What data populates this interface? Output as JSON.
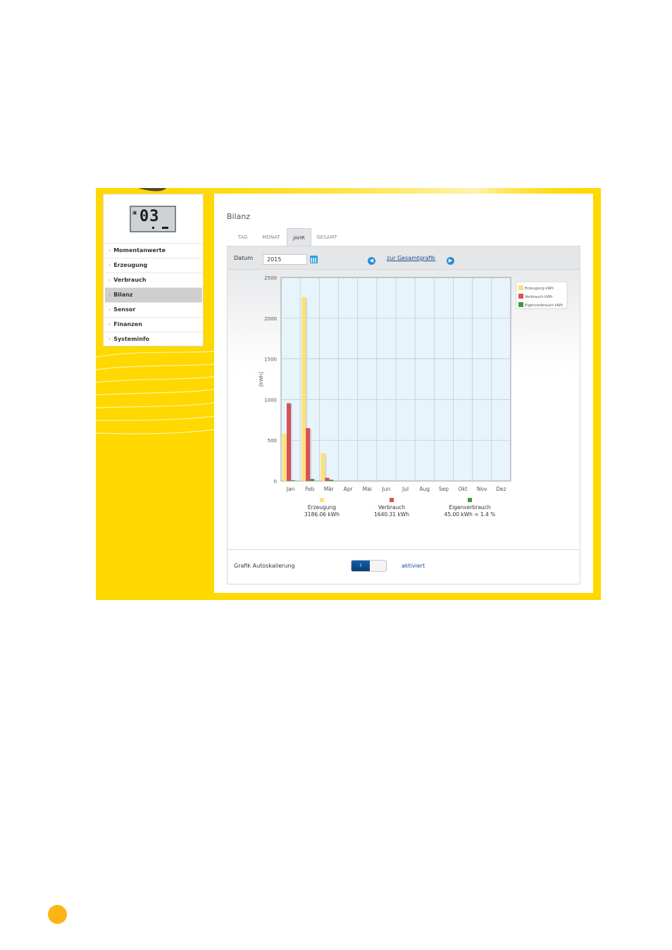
{
  "sidebar": {
    "lcd_value": "03",
    "items": [
      {
        "label": "Momentanwerte",
        "active": false
      },
      {
        "label": "Erzeugung",
        "active": false
      },
      {
        "label": "Verbrauch",
        "active": false
      },
      {
        "label": "Bilanz",
        "active": true
      },
      {
        "label": "Sensor",
        "active": false
      },
      {
        "label": "Finanzen",
        "active": false
      },
      {
        "label": "Systeminfo",
        "active": false
      }
    ]
  },
  "panel": {
    "title": "Bilanz",
    "tabs": [
      {
        "label": "TAG",
        "active": false
      },
      {
        "label": "MONAT",
        "active": false
      },
      {
        "label": "JAHR",
        "active": true
      },
      {
        "label": "GESAMT",
        "active": false
      }
    ]
  },
  "date": {
    "label": "Datum",
    "value": "2015",
    "link_label": "zur Gesamtgrafik",
    "prev_icon": "arrow-left-icon",
    "next_icon": "arrow-right-icon",
    "calendar_icon": "calendar-icon"
  },
  "autoscale": {
    "label": "Grafik Autoskalierung",
    "toggle_label": "I",
    "status": "aktiviert"
  },
  "colors": {
    "background": "#ffd800",
    "erzeugung": "#fbe27a",
    "verbrauch": "#d8505a",
    "eigenverbrauch": "#3e9a3a",
    "plot_background": "#e8f4fc",
    "link": "#1d4e8f"
  },
  "chart_data": {
    "type": "bar",
    "categories": [
      "Jan",
      "Feb",
      "Mär",
      "Apr",
      "Mai",
      "Jun",
      "Jul",
      "Aug",
      "Sep",
      "Okt",
      "Nov",
      "Dez"
    ],
    "series": [
      {
        "name": "Erzeugung kWh",
        "values": [
          580,
          2260,
          345,
          0,
          0,
          0,
          0,
          0,
          0,
          0,
          0,
          0
        ]
      },
      {
        "name": "Verbrauch kWh",
        "values": [
          955,
          650,
          40,
          0,
          0,
          0,
          0,
          0,
          0,
          0,
          0,
          0
        ]
      },
      {
        "name": "Eigenverbrauch kWh",
        "values": [
          8,
          25,
          15,
          0,
          0,
          0,
          0,
          0,
          0,
          0,
          0,
          0
        ]
      }
    ],
    "ylabel": "[kWh]",
    "ylim": [
      0,
      2500
    ],
    "yticks": [
      0,
      500,
      1000,
      1500,
      2000,
      2500
    ],
    "grid": true,
    "legend": "top-right",
    "summary": [
      {
        "label": "Erzeugung",
        "value": "3186.06 kWh"
      },
      {
        "label": "Verbrauch",
        "value": "1640.31 kWh"
      },
      {
        "label": "Eigenverbrauch",
        "value": "45.00 kWh = 1.4 %"
      }
    ]
  }
}
